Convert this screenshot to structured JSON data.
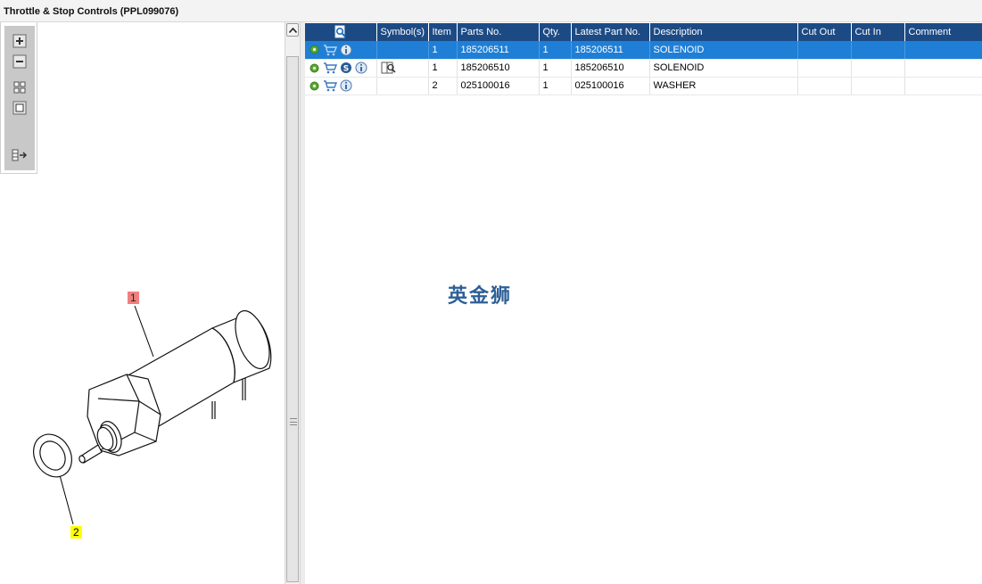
{
  "window": {
    "title": "Throttle & Stop Controls (PPL099076)"
  },
  "toolbar": {
    "buttons": [
      {
        "icon": "zoom-in-icon"
      },
      {
        "icon": "zoom-out-icon"
      },
      {
        "icon": "fit-all-icon"
      },
      {
        "icon": "fit-window-icon"
      },
      {
        "icon": "export-icon"
      }
    ]
  },
  "drawing": {
    "callouts": [
      "1",
      "2"
    ],
    "callout_colors": {
      "item1": "#f08080",
      "item2": "#ffff00"
    }
  },
  "table": {
    "headers": [
      "",
      "Symbol(s)",
      "Item",
      "Parts No.",
      "Qty.",
      "Latest Part No.",
      "Description",
      "Cut Out",
      "Cut In",
      "Comment"
    ],
    "rows": [
      {
        "icons": [
          "gear-icon",
          "cart-icon",
          "info-icon"
        ],
        "symbols": "",
        "item": "1",
        "part_no": "185206511",
        "qty": "1",
        "latest_part_no": "185206511",
        "description": "SOLENOID",
        "cut_out": "",
        "cut_in": "",
        "comment": "",
        "selected": true
      },
      {
        "icons": [
          "gear-icon",
          "cart-icon",
          "s-badge-icon",
          "info-icon"
        ],
        "symbols": "book-search-icon",
        "item": "1",
        "part_no": "185206510",
        "qty": "1",
        "latest_part_no": "185206510",
        "description": "SOLENOID",
        "cut_out": "",
        "cut_in": "",
        "comment": "",
        "selected": false
      },
      {
        "icons": [
          "gear-icon",
          "cart-icon",
          "info-icon"
        ],
        "symbols": "",
        "item": "2",
        "part_no": "025100016",
        "qty": "1",
        "latest_part_no": "025100016",
        "description": "WASHER",
        "cut_out": "",
        "cut_in": "",
        "comment": "",
        "selected": false
      }
    ]
  },
  "watermark": "英金狮",
  "colors": {
    "header_bg": "#1c4a85",
    "selected_row": "#1f7fd6",
    "watermark": "#2d5f97"
  }
}
